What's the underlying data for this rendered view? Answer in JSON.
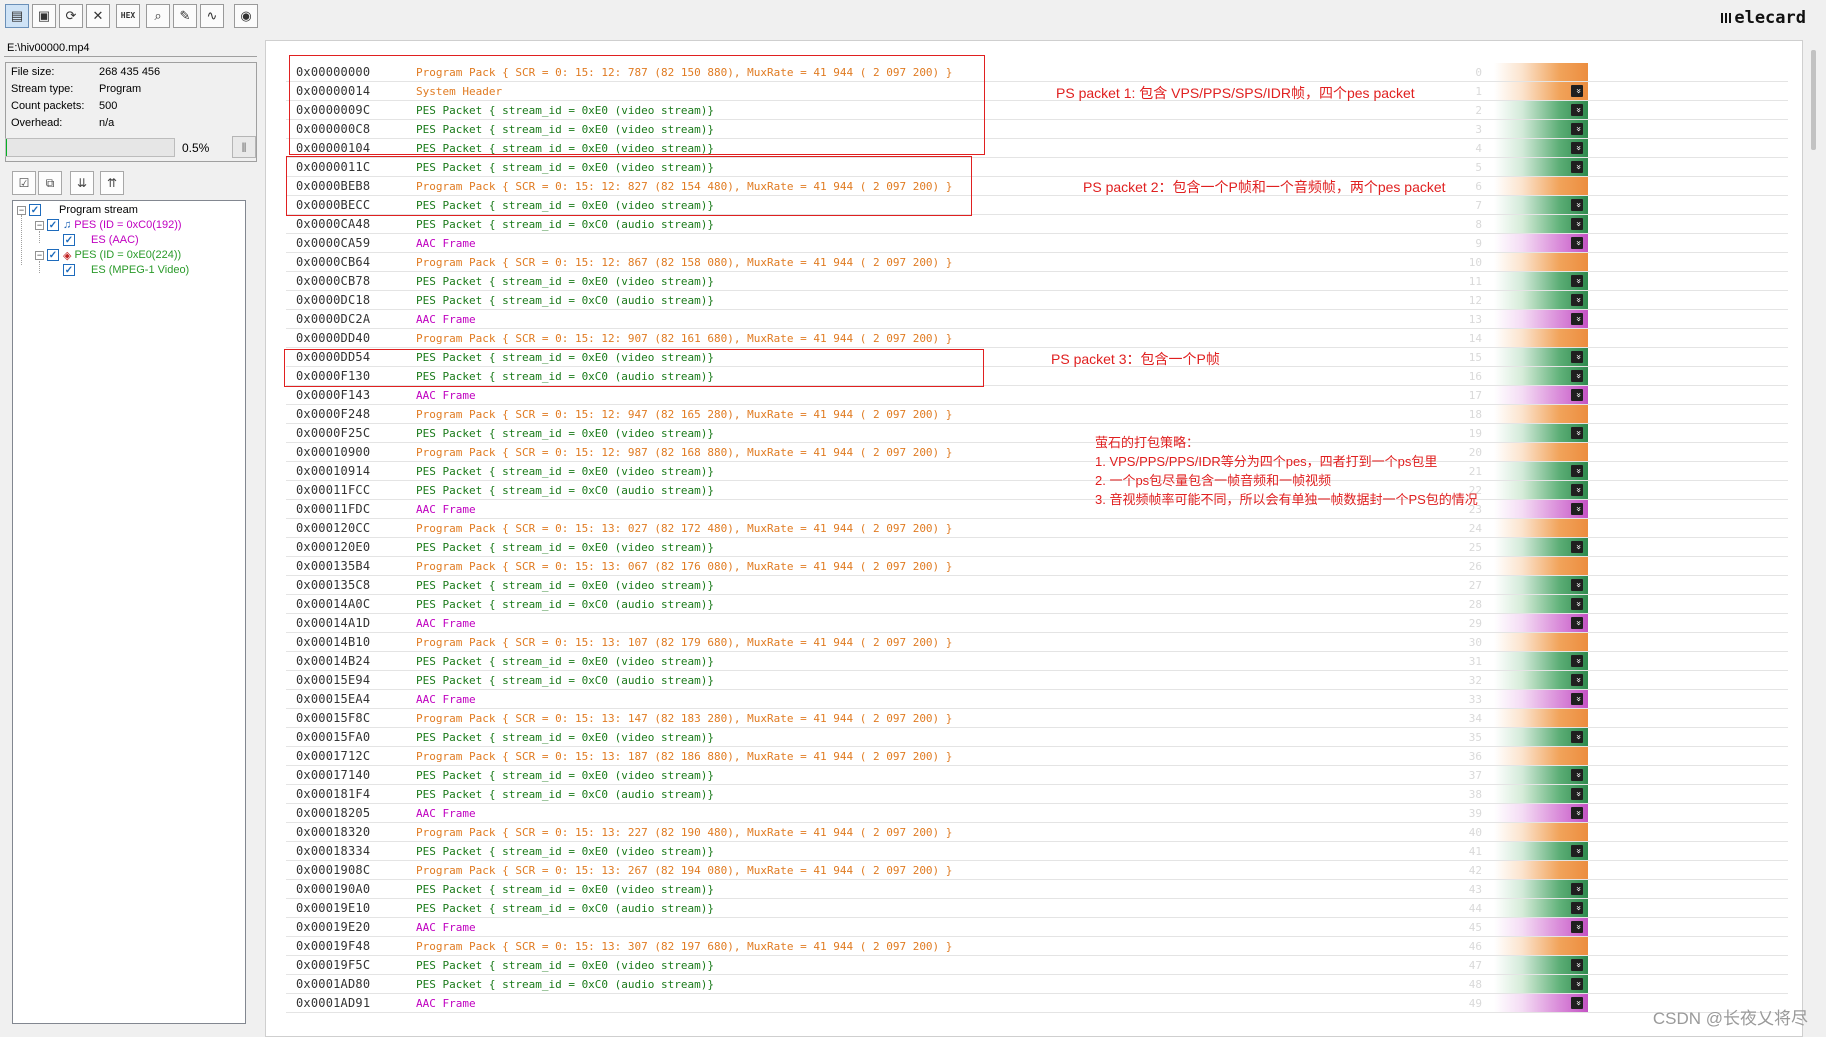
{
  "toolbar": {
    "buttons": [
      {
        "name": "open-icon",
        "glyph": "▤"
      },
      {
        "name": "save-icon",
        "glyph": "▣"
      },
      {
        "name": "refresh-icon",
        "glyph": "⟳"
      },
      {
        "name": "close-icon",
        "glyph": "✕"
      },
      {
        "name": "hex-icon",
        "glyph": "HEX"
      },
      {
        "name": "search-icon",
        "glyph": "⌕"
      },
      {
        "name": "edit-icon",
        "glyph": "✎"
      },
      {
        "name": "chart-icon",
        "glyph": "∿"
      },
      {
        "name": "disk-icon",
        "glyph": "◉"
      }
    ],
    "brand": "elecard"
  },
  "file": {
    "path": "E:\\hiv00000.mp4",
    "info": [
      {
        "label": "File size:",
        "value": "268 435 456"
      },
      {
        "label": "Stream type:",
        "value": "Program"
      },
      {
        "label": "Count packets:",
        "value": "500"
      },
      {
        "label": "Overhead:",
        "value": "n/a"
      }
    ],
    "progress_text": "0.5%",
    "progress_fraction": 0.005
  },
  "tree": {
    "root": "Program stream",
    "audio_pes": "PES (ID = 0xC0(192))",
    "audio_es": "ES (AAC)",
    "video_pes": "PES (ID = 0xE0(224))",
    "video_es": "ES (MPEG-1 Video)",
    "colors": {
      "audio": "#c000c0",
      "video": "#2a9a2a"
    }
  },
  "packets": [
    {
      "offset": "0x00000000",
      "desc": "Program Pack { SCR =  0: 15: 12: 787 (82 150 880), MuxRate = 41 944 ( 2 097 200) }",
      "kind": "pack",
      "idx": "0"
    },
    {
      "offset": "0x00000014",
      "desc": "System Header",
      "kind": "sys",
      "idx": "1"
    },
    {
      "offset": "0x0000009C",
      "desc": "PES Packet { stream_id = 0xE0  (video stream)}",
      "kind": "video",
      "idx": "2"
    },
    {
      "offset": "0x000000C8",
      "desc": "PES Packet { stream_id = 0xE0  (video stream)}",
      "kind": "video",
      "idx": "3"
    },
    {
      "offset": "0x00000104",
      "desc": "PES Packet { stream_id = 0xE0  (video stream)}",
      "kind": "video",
      "idx": "4"
    },
    {
      "offset": "0x0000011C",
      "desc": "PES Packet { stream_id = 0xE0  (video stream)}",
      "kind": "video",
      "idx": "5"
    },
    {
      "offset": "0x0000BEB8",
      "desc": "Program Pack { SCR =  0: 15: 12: 827 (82 154 480), MuxRate = 41 944 ( 2 097 200) }",
      "kind": "pack",
      "idx": "6"
    },
    {
      "offset": "0x0000BECC",
      "desc": "PES Packet { stream_id = 0xE0  (video stream)}",
      "kind": "video",
      "idx": "7"
    },
    {
      "offset": "0x0000CA48",
      "desc": "PES Packet { stream_id = 0xC0  (audio stream)}",
      "kind": "audio",
      "idx": "8"
    },
    {
      "offset": "0x0000CA59",
      "desc": "AAC Frame",
      "kind": "aac",
      "idx": "9"
    },
    {
      "offset": "0x0000CB64",
      "desc": "Program Pack { SCR =  0: 15: 12: 867 (82 158 080), MuxRate = 41 944 ( 2 097 200) }",
      "kind": "pack",
      "idx": "10"
    },
    {
      "offset": "0x0000CB78",
      "desc": "PES Packet { stream_id = 0xE0  (video stream)}",
      "kind": "video",
      "idx": "11"
    },
    {
      "offset": "0x0000DC18",
      "desc": "PES Packet { stream_id = 0xC0  (audio stream)}",
      "kind": "audio",
      "idx": "12"
    },
    {
      "offset": "0x0000DC2A",
      "desc": "AAC Frame",
      "kind": "aac",
      "idx": "13"
    },
    {
      "offset": "0x0000DD40",
      "desc": "Program Pack { SCR =  0: 15: 12: 907 (82 161 680), MuxRate = 41 944 ( 2 097 200) }",
      "kind": "pack",
      "idx": "14"
    },
    {
      "offset": "0x0000DD54",
      "desc": "PES Packet { stream_id = 0xE0  (video stream)}",
      "kind": "video",
      "idx": "15"
    },
    {
      "offset": "0x0000F130",
      "desc": "PES Packet { stream_id = 0xC0  (audio stream)}",
      "kind": "audio",
      "idx": "16"
    },
    {
      "offset": "0x0000F143",
      "desc": "AAC Frame",
      "kind": "aac",
      "idx": "17"
    },
    {
      "offset": "0x0000F248",
      "desc": "Program Pack { SCR =  0: 15: 12: 947 (82 165 280), MuxRate = 41 944 ( 2 097 200) }",
      "kind": "pack",
      "idx": "18"
    },
    {
      "offset": "0x0000F25C",
      "desc": "PES Packet { stream_id = 0xE0  (video stream)}",
      "kind": "video",
      "idx": "19"
    },
    {
      "offset": "0x00010900",
      "desc": "Program Pack { SCR =  0: 15: 12: 987 (82 168 880), MuxRate = 41 944 ( 2 097 200) }",
      "kind": "pack",
      "idx": "20"
    },
    {
      "offset": "0x00010914",
      "desc": "PES Packet { stream_id = 0xE0  (video stream)}",
      "kind": "video",
      "idx": "21"
    },
    {
      "offset": "0x00011FCC",
      "desc": "PES Packet { stream_id = 0xC0  (audio stream)}",
      "kind": "audio",
      "idx": "22"
    },
    {
      "offset": "0x00011FDC",
      "desc": "AAC Frame",
      "kind": "aac",
      "idx": "23"
    },
    {
      "offset": "0x000120CC",
      "desc": "Program Pack { SCR =  0: 15: 13: 027 (82 172 480), MuxRate = 41 944 ( 2 097 200) }",
      "kind": "pack",
      "idx": "24"
    },
    {
      "offset": "0x000120E0",
      "desc": "PES Packet { stream_id = 0xE0  (video stream)}",
      "kind": "video",
      "idx": "25"
    },
    {
      "offset": "0x000135B4",
      "desc": "Program Pack { SCR =  0: 15: 13: 067 (82 176 080), MuxRate = 41 944 ( 2 097 200) }",
      "kind": "pack",
      "idx": "26"
    },
    {
      "offset": "0x000135C8",
      "desc": "PES Packet { stream_id = 0xE0  (video stream)}",
      "kind": "video",
      "idx": "27"
    },
    {
      "offset": "0x00014A0C",
      "desc": "PES Packet { stream_id = 0xC0  (audio stream)}",
      "kind": "audio",
      "idx": "28"
    },
    {
      "offset": "0x00014A1D",
      "desc": "AAC Frame",
      "kind": "aac",
      "idx": "29"
    },
    {
      "offset": "0x00014B10",
      "desc": "Program Pack { SCR =  0: 15: 13: 107 (82 179 680), MuxRate = 41 944 ( 2 097 200) }",
      "kind": "pack",
      "idx": "30"
    },
    {
      "offset": "0x00014B24",
      "desc": "PES Packet { stream_id = 0xE0  (video stream)}",
      "kind": "video",
      "idx": "31"
    },
    {
      "offset": "0x00015E94",
      "desc": "PES Packet { stream_id = 0xC0  (audio stream)}",
      "kind": "audio",
      "idx": "32"
    },
    {
      "offset": "0x00015EA4",
      "desc": "AAC Frame",
      "kind": "aac",
      "idx": "33"
    },
    {
      "offset": "0x00015F8C",
      "desc": "Program Pack { SCR =  0: 15: 13: 147 (82 183 280), MuxRate = 41 944 ( 2 097 200) }",
      "kind": "pack",
      "idx": "34"
    },
    {
      "offset": "0x00015FA0",
      "desc": "PES Packet { stream_id = 0xE0  (video stream)}",
      "kind": "video",
      "idx": "35"
    },
    {
      "offset": "0x0001712C",
      "desc": "Program Pack { SCR =  0: 15: 13: 187 (82 186 880), MuxRate = 41 944 ( 2 097 200) }",
      "kind": "pack",
      "idx": "36"
    },
    {
      "offset": "0x00017140",
      "desc": "PES Packet { stream_id = 0xE0  (video stream)}",
      "kind": "video",
      "idx": "37"
    },
    {
      "offset": "0x000181F4",
      "desc": "PES Packet { stream_id = 0xC0  (audio stream)}",
      "kind": "audio",
      "idx": "38"
    },
    {
      "offset": "0x00018205",
      "desc": "AAC Frame",
      "kind": "aac",
      "idx": "39"
    },
    {
      "offset": "0x00018320",
      "desc": "Program Pack { SCR =  0: 15: 13: 227 (82 190 480), MuxRate = 41 944 ( 2 097 200) }",
      "kind": "pack",
      "idx": "40"
    },
    {
      "offset": "0x00018334",
      "desc": "PES Packet { stream_id = 0xE0  (video stream)}",
      "kind": "video",
      "idx": "41"
    },
    {
      "offset": "0x0001908C",
      "desc": "Program Pack { SCR =  0: 15: 13: 267 (82 194 080), MuxRate = 41 944 ( 2 097 200) }",
      "kind": "pack",
      "idx": "42"
    },
    {
      "offset": "0x000190A0",
      "desc": "PES Packet { stream_id = 0xE0  (video stream)}",
      "kind": "video",
      "idx": "43"
    },
    {
      "offset": "0x00019E10",
      "desc": "PES Packet { stream_id = 0xC0  (audio stream)}",
      "kind": "audio",
      "idx": "44"
    },
    {
      "offset": "0x00019E20",
      "desc": "AAC Frame",
      "kind": "aac",
      "idx": "45"
    },
    {
      "offset": "0x00019F48",
      "desc": "Program Pack { SCR =  0: 15: 13: 307 (82 197 680), MuxRate = 41 944 ( 2 097 200) }",
      "kind": "pack",
      "idx": "46"
    },
    {
      "offset": "0x00019F5C",
      "desc": "PES Packet { stream_id = 0xE0  (video stream)}",
      "kind": "video",
      "idx": "47"
    },
    {
      "offset": "0x0001AD80",
      "desc": "PES Packet { stream_id = 0xC0  (audio stream)}",
      "kind": "audio",
      "idx": "48"
    },
    {
      "offset": "0x0001AD91",
      "desc": "AAC Frame",
      "kind": "aac",
      "idx": "49"
    }
  ],
  "colors": {
    "pack": "#e07b22",
    "sys": "#e07b22",
    "video": "#1a7a1a",
    "audio": "#1a7a1a",
    "aac": "#c000c0",
    "annotation": "#e02020"
  },
  "annotations": {
    "ps1": "PS packet 1: 包含 VPS/PPS/SPS/IDR帧，四个pes packet",
    "ps2": "PS packet 2：包含一个P帧和一个音频帧，两个pes packet",
    "ps3": "PS packet 3：包含一个P帧",
    "strategy_title": "萤石的打包策略：",
    "strategy_lines": [
      "1. VPS/PPS/PPS/IDR等分为四个pes，四者打到一个ps包里",
      "2. 一个ps包尽量包含一帧音频和一帧视频",
      "3. 音视频帧率可能不同，所以会有单独一帧数据封一个PS包的情况"
    ]
  },
  "watermark": "CSDN @长夜乂将尽"
}
